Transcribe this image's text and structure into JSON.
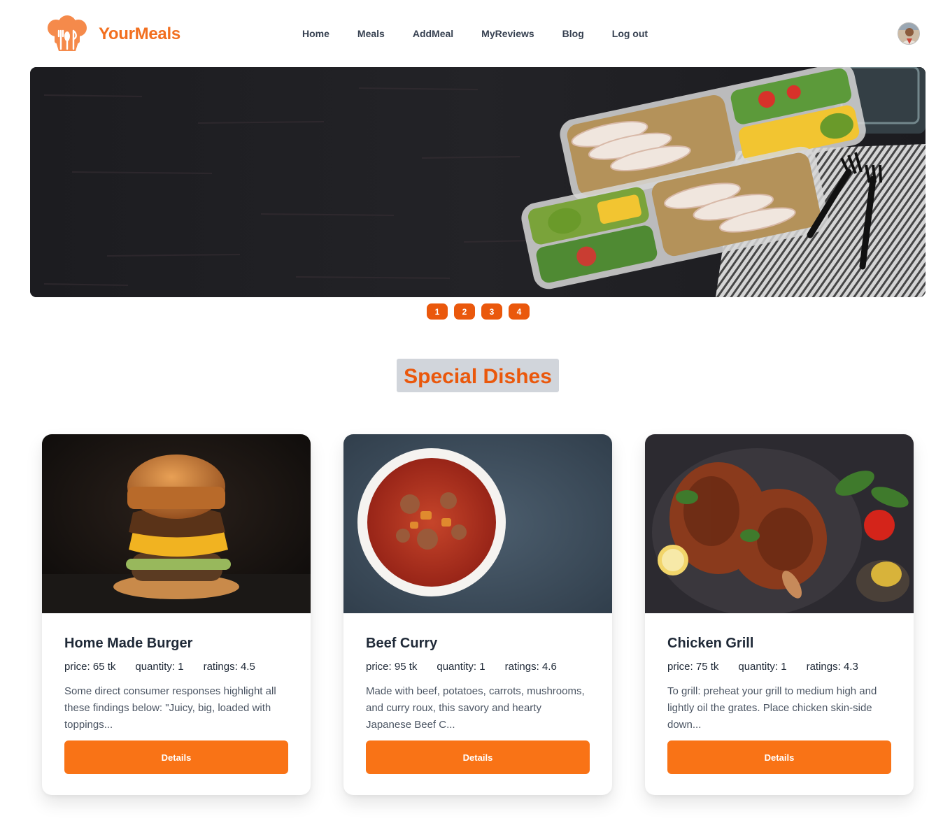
{
  "brand": {
    "name": "YourMeals",
    "logo_icon": "chef-hat-utensils-icon",
    "color": "#f26f1f"
  },
  "nav": {
    "items": [
      {
        "label": "Home"
      },
      {
        "label": "Meals"
      },
      {
        "label": "AddMeal"
      },
      {
        "label": "MyReviews"
      },
      {
        "label": "Blog"
      },
      {
        "label": "Log out"
      }
    ]
  },
  "hero": {
    "image": "meal-prep-containers-on-dark-wood",
    "slides": [
      "1",
      "2",
      "3",
      "4"
    ]
  },
  "section": {
    "title": "Special Dishes"
  },
  "dishes": [
    {
      "name": "Home Made Burger",
      "price": "price: 65 tk",
      "quantity": "quantity: 1",
      "ratings": "ratings: 4.5",
      "description": "Some direct consumer responses highlight all these findings below: \"Juicy, big, loaded with toppings...",
      "button": "Details",
      "image": "burger-photo"
    },
    {
      "name": "Beef Curry",
      "price": "price: 95 tk",
      "quantity": "quantity: 1",
      "ratings": "ratings: 4.6",
      "description": "Made with beef, potatoes, carrots, mushrooms, and curry roux, this savory and hearty Japanese Beef C...",
      "button": "Details",
      "image": "beef-curry-bowl-photo"
    },
    {
      "name": "Chicken Grill",
      "price": "price: 75 tk",
      "quantity": "quantity: 1",
      "ratings": "ratings: 4.3",
      "description": "To grill: preheat your grill to medium high and lightly oil the grates. Place chicken skin-side down...",
      "button": "Details",
      "image": "grilled-chicken-photo"
    }
  ],
  "colors": {
    "accent": "#f97316",
    "accent_dark": "#ea580c",
    "title_bg": "#d1d5db"
  }
}
